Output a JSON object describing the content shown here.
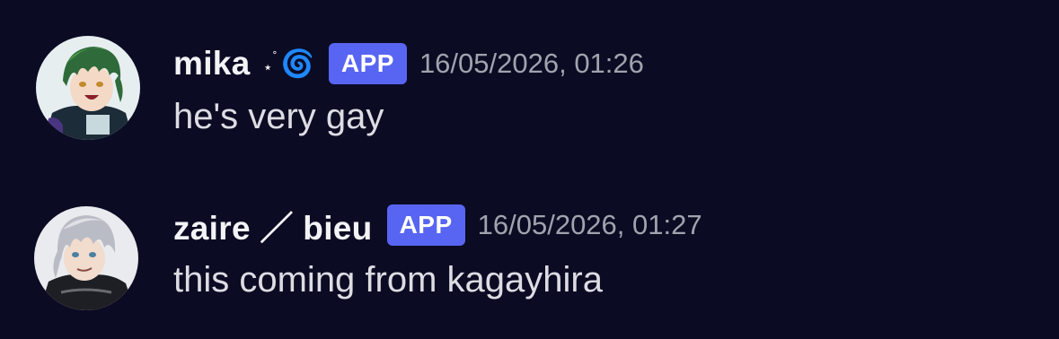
{
  "messages": [
    {
      "username": "mika",
      "decoration": {
        "star": "⋆",
        "ring": "˚",
        "swirl": "🌀"
      },
      "badge": "APP",
      "timestamp": "16/05/2026, 01:26",
      "text": "he's very gay",
      "avatar_icon": "green-haired-character-avatar"
    },
    {
      "username": "zaire ／ bieu",
      "badge": "APP",
      "timestamp": "16/05/2026, 01:27",
      "text": "this coming from kagayhira",
      "avatar_icon": "silver-haired-character-avatar"
    }
  ],
  "colors": {
    "background": "#0b0b24",
    "badge": "#5865f2",
    "username": "#f2f3f5",
    "timestamp": "#a1a3ad",
    "message_text": "#dcdde3"
  }
}
